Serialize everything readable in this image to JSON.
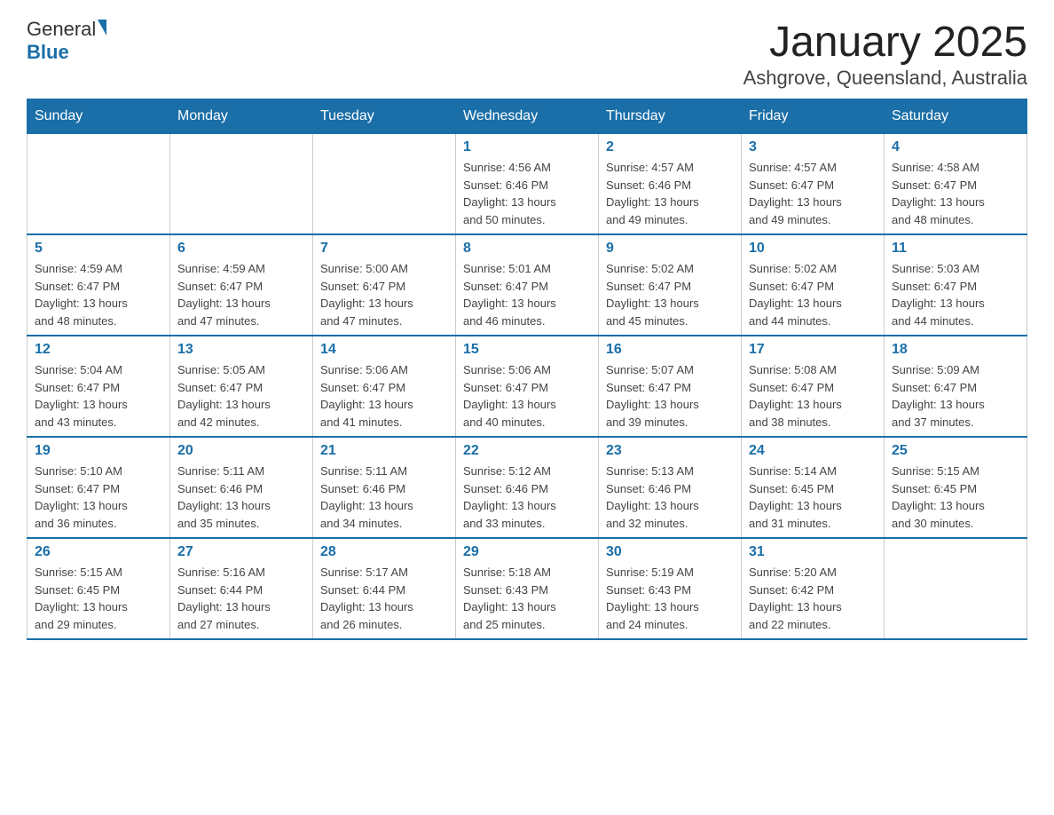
{
  "logo": {
    "text_general": "General",
    "text_blue": "Blue"
  },
  "title": "January 2025",
  "subtitle": "Ashgrove, Queensland, Australia",
  "days_of_week": [
    "Sunday",
    "Monday",
    "Tuesday",
    "Wednesday",
    "Thursday",
    "Friday",
    "Saturday"
  ],
  "weeks": [
    [
      {
        "day": "",
        "info": ""
      },
      {
        "day": "",
        "info": ""
      },
      {
        "day": "",
        "info": ""
      },
      {
        "day": "1",
        "info": "Sunrise: 4:56 AM\nSunset: 6:46 PM\nDaylight: 13 hours\nand 50 minutes."
      },
      {
        "day": "2",
        "info": "Sunrise: 4:57 AM\nSunset: 6:46 PM\nDaylight: 13 hours\nand 49 minutes."
      },
      {
        "day": "3",
        "info": "Sunrise: 4:57 AM\nSunset: 6:47 PM\nDaylight: 13 hours\nand 49 minutes."
      },
      {
        "day": "4",
        "info": "Sunrise: 4:58 AM\nSunset: 6:47 PM\nDaylight: 13 hours\nand 48 minutes."
      }
    ],
    [
      {
        "day": "5",
        "info": "Sunrise: 4:59 AM\nSunset: 6:47 PM\nDaylight: 13 hours\nand 48 minutes."
      },
      {
        "day": "6",
        "info": "Sunrise: 4:59 AM\nSunset: 6:47 PM\nDaylight: 13 hours\nand 47 minutes."
      },
      {
        "day": "7",
        "info": "Sunrise: 5:00 AM\nSunset: 6:47 PM\nDaylight: 13 hours\nand 47 minutes."
      },
      {
        "day": "8",
        "info": "Sunrise: 5:01 AM\nSunset: 6:47 PM\nDaylight: 13 hours\nand 46 minutes."
      },
      {
        "day": "9",
        "info": "Sunrise: 5:02 AM\nSunset: 6:47 PM\nDaylight: 13 hours\nand 45 minutes."
      },
      {
        "day": "10",
        "info": "Sunrise: 5:02 AM\nSunset: 6:47 PM\nDaylight: 13 hours\nand 44 minutes."
      },
      {
        "day": "11",
        "info": "Sunrise: 5:03 AM\nSunset: 6:47 PM\nDaylight: 13 hours\nand 44 minutes."
      }
    ],
    [
      {
        "day": "12",
        "info": "Sunrise: 5:04 AM\nSunset: 6:47 PM\nDaylight: 13 hours\nand 43 minutes."
      },
      {
        "day": "13",
        "info": "Sunrise: 5:05 AM\nSunset: 6:47 PM\nDaylight: 13 hours\nand 42 minutes."
      },
      {
        "day": "14",
        "info": "Sunrise: 5:06 AM\nSunset: 6:47 PM\nDaylight: 13 hours\nand 41 minutes."
      },
      {
        "day": "15",
        "info": "Sunrise: 5:06 AM\nSunset: 6:47 PM\nDaylight: 13 hours\nand 40 minutes."
      },
      {
        "day": "16",
        "info": "Sunrise: 5:07 AM\nSunset: 6:47 PM\nDaylight: 13 hours\nand 39 minutes."
      },
      {
        "day": "17",
        "info": "Sunrise: 5:08 AM\nSunset: 6:47 PM\nDaylight: 13 hours\nand 38 minutes."
      },
      {
        "day": "18",
        "info": "Sunrise: 5:09 AM\nSunset: 6:47 PM\nDaylight: 13 hours\nand 37 minutes."
      }
    ],
    [
      {
        "day": "19",
        "info": "Sunrise: 5:10 AM\nSunset: 6:47 PM\nDaylight: 13 hours\nand 36 minutes."
      },
      {
        "day": "20",
        "info": "Sunrise: 5:11 AM\nSunset: 6:46 PM\nDaylight: 13 hours\nand 35 minutes."
      },
      {
        "day": "21",
        "info": "Sunrise: 5:11 AM\nSunset: 6:46 PM\nDaylight: 13 hours\nand 34 minutes."
      },
      {
        "day": "22",
        "info": "Sunrise: 5:12 AM\nSunset: 6:46 PM\nDaylight: 13 hours\nand 33 minutes."
      },
      {
        "day": "23",
        "info": "Sunrise: 5:13 AM\nSunset: 6:46 PM\nDaylight: 13 hours\nand 32 minutes."
      },
      {
        "day": "24",
        "info": "Sunrise: 5:14 AM\nSunset: 6:45 PM\nDaylight: 13 hours\nand 31 minutes."
      },
      {
        "day": "25",
        "info": "Sunrise: 5:15 AM\nSunset: 6:45 PM\nDaylight: 13 hours\nand 30 minutes."
      }
    ],
    [
      {
        "day": "26",
        "info": "Sunrise: 5:15 AM\nSunset: 6:45 PM\nDaylight: 13 hours\nand 29 minutes."
      },
      {
        "day": "27",
        "info": "Sunrise: 5:16 AM\nSunset: 6:44 PM\nDaylight: 13 hours\nand 27 minutes."
      },
      {
        "day": "28",
        "info": "Sunrise: 5:17 AM\nSunset: 6:44 PM\nDaylight: 13 hours\nand 26 minutes."
      },
      {
        "day": "29",
        "info": "Sunrise: 5:18 AM\nSunset: 6:43 PM\nDaylight: 13 hours\nand 25 minutes."
      },
      {
        "day": "30",
        "info": "Sunrise: 5:19 AM\nSunset: 6:43 PM\nDaylight: 13 hours\nand 24 minutes."
      },
      {
        "day": "31",
        "info": "Sunrise: 5:20 AM\nSunset: 6:42 PM\nDaylight: 13 hours\nand 22 minutes."
      },
      {
        "day": "",
        "info": ""
      }
    ]
  ]
}
